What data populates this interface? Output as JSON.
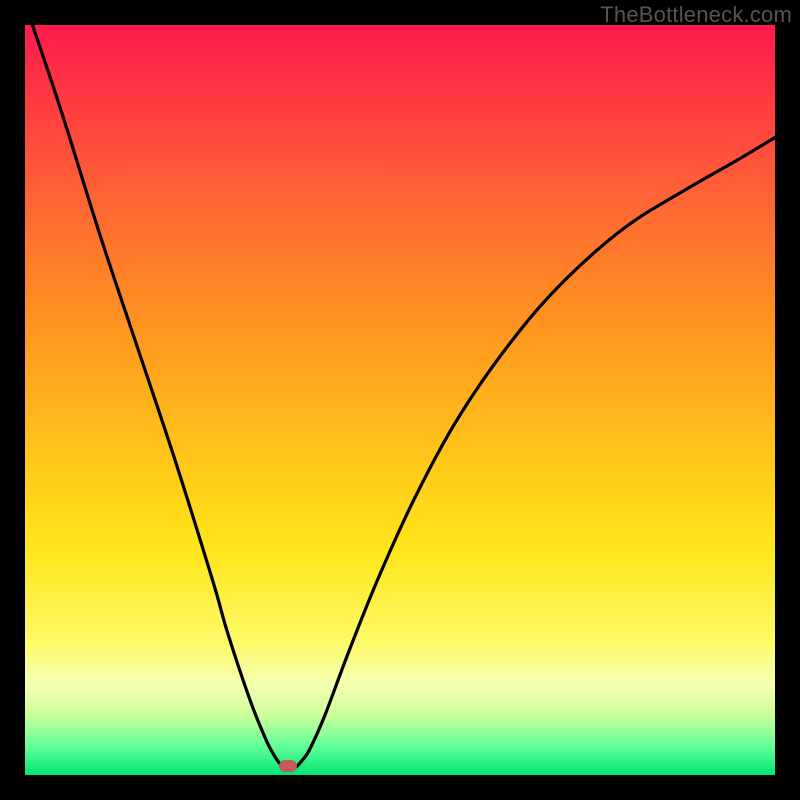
{
  "watermark": "TheBottleneck.com",
  "chart_data": {
    "type": "line",
    "title": "",
    "xlabel": "",
    "ylabel": "",
    "xlim": [
      0,
      100
    ],
    "ylim": [
      0,
      100
    ],
    "grid": false,
    "legend": false,
    "series": [
      {
        "name": "bottleneck-curve",
        "x": [
          1,
          5,
          10,
          15,
          20,
          25,
          27,
          30,
          32,
          33,
          34,
          35,
          36,
          37,
          38,
          40,
          43,
          47,
          52,
          58,
          65,
          72,
          80,
          88,
          95,
          100
        ],
        "values": [
          100,
          88,
          72,
          57,
          42,
          26,
          19,
          10,
          5,
          3,
          1.5,
          1,
          1,
          2,
          3.5,
          8,
          16,
          26,
          37,
          48,
          58,
          66,
          73,
          78,
          82,
          85
        ]
      }
    ],
    "annotations": [
      {
        "type": "marker",
        "shape": "rounded-rect",
        "x": 35,
        "y": 1,
        "color": "#c45a5a"
      }
    ],
    "background_gradient": {
      "direction": "vertical",
      "stops": [
        {
          "pos": 0,
          "color": "#ff1a4d"
        },
        {
          "pos": 0.5,
          "color": "#ffbf1a"
        },
        {
          "pos": 0.85,
          "color": "#fff966"
        },
        {
          "pos": 1.0,
          "color": "#00e673"
        }
      ]
    }
  },
  "colors": {
    "curve": "#000000",
    "frame_bg": "#000000",
    "marker": "#c45a5a"
  }
}
